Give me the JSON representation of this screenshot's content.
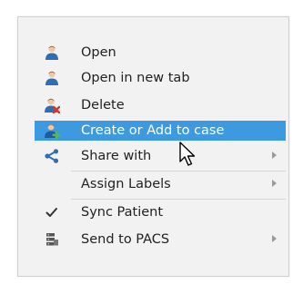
{
  "menu": {
    "items": [
      {
        "label": "Open",
        "icon": "person-icon"
      },
      {
        "label": "Open in new tab",
        "icon": "person-icon"
      },
      {
        "label": "Delete",
        "icon": "person-delete-icon"
      },
      {
        "label": "Create or Add to case",
        "icon": "person-add-icon",
        "highlighted": true
      },
      {
        "label": "Share with",
        "icon": "share-icon",
        "submenu": true
      },
      {
        "label": "Assign Labels",
        "submenu": true
      },
      {
        "label": "Sync Patient",
        "icon": "checkmark-icon",
        "checked": true
      },
      {
        "label": "Send to PACS",
        "icon": "server-icon",
        "submenu": true
      }
    ]
  },
  "colors": {
    "highlight": "#3d9ae0",
    "menu_bg": "#f2f2f2",
    "person_icon": "#2f6db5",
    "delete_icon": "#d9342b",
    "add_icon": "#58b947",
    "share_icon": "#2f6db5"
  }
}
